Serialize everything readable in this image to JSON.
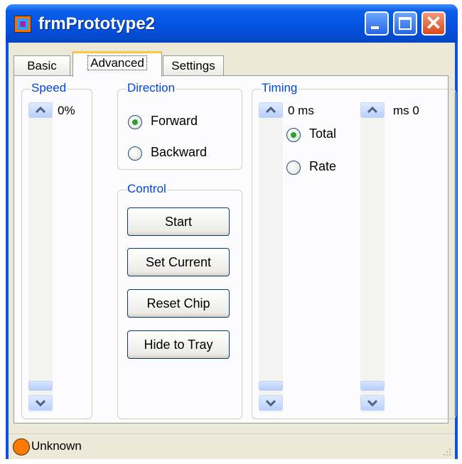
{
  "window": {
    "title": "frmPrototype2",
    "close_glyph": "✕"
  },
  "tabs": [
    {
      "label": "Basic"
    },
    {
      "label": "Advanced"
    },
    {
      "label": "Settings"
    }
  ],
  "speed": {
    "label": "Speed",
    "value": "0%"
  },
  "direction": {
    "label": "Direction",
    "options": [
      {
        "label": "Forward",
        "selected": true
      },
      {
        "label": "Backward",
        "selected": false
      }
    ]
  },
  "control": {
    "label": "Control",
    "buttons": [
      {
        "label": "Start"
      },
      {
        "label": "Set Current"
      },
      {
        "label": "Reset Chip"
      },
      {
        "label": "Hide to Tray"
      }
    ]
  },
  "timing": {
    "label": "Timing",
    "left_value": "0 ms",
    "right_value": "ms 0",
    "options": [
      {
        "label": "Total",
        "selected": true
      },
      {
        "label": "Rate",
        "selected": false
      }
    ]
  },
  "status": {
    "text": "Unknown",
    "indicator_color": "#ff7a00"
  },
  "colors": {
    "titlebar": "#0551e0",
    "group_label": "#0046d5",
    "tab_highlight": "#ffc83c"
  }
}
